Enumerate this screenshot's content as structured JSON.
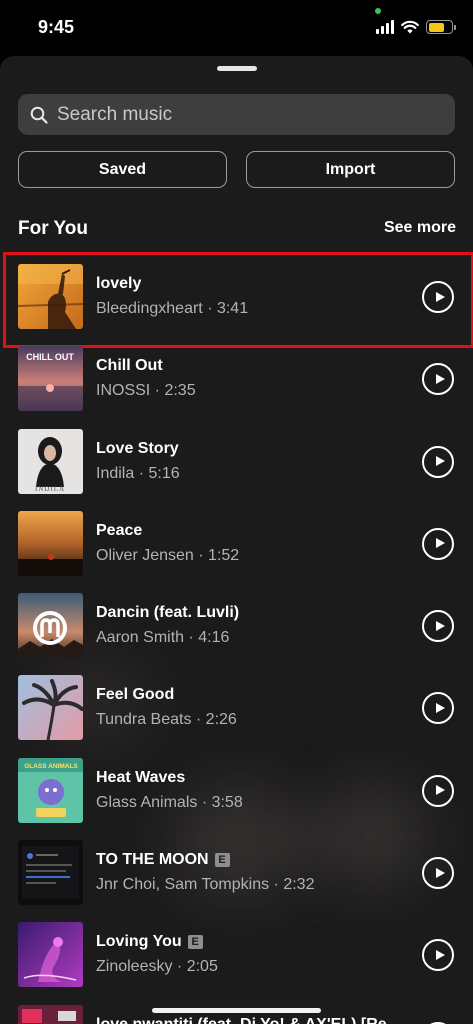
{
  "status_bar": {
    "time": "9:45",
    "signal_icon": "cellular-signal-icon",
    "wifi_icon": "wifi-icon",
    "battery_icon": "battery-icon",
    "battery_color": "#f5c518",
    "privacy_indicator_color": "#34c759"
  },
  "search": {
    "placeholder": "Search music",
    "icon": "search-icon"
  },
  "buttons": {
    "saved": "Saved",
    "import": "Import"
  },
  "section": {
    "title": "For You",
    "see_more": "See more"
  },
  "selection_color": "#e30f18",
  "tracks": [
    {
      "title": "lovely",
      "meta": "Bleedingxheart · 3:41",
      "explicit": false,
      "selected": true
    },
    {
      "title": "Chill Out",
      "meta": "INOSSI · 2:35",
      "explicit": false,
      "cover_text": "CHILL OUT"
    },
    {
      "title": "Love Story",
      "meta": "Indila · 5:16",
      "explicit": false,
      "cover_text": "INDILA"
    },
    {
      "title": "Peace",
      "meta": "Oliver Jensen · 1:52",
      "explicit": false
    },
    {
      "title": "Dancin (feat. Luvli)",
      "meta": "Aaron Smith · 4:16",
      "explicit": false
    },
    {
      "title": "Feel Good",
      "meta": "Tundra Beats · 2:26",
      "explicit": false
    },
    {
      "title": "Heat Waves",
      "meta": "Glass Animals · 3:58",
      "explicit": false,
      "cover_text": "GLASS ANIMALS"
    },
    {
      "title": "TO THE MOON",
      "meta": "Jnr Choi, Sam Tompkins · 2:32",
      "explicit": true
    },
    {
      "title": "Loving You",
      "meta": "Zinoleesky · 2:05",
      "explicit": true
    },
    {
      "title": "love nwantiti (feat. Dj Yo! & AX'EL) [Re",
      "meta": "",
      "explicit": false
    }
  ],
  "explicit_label": "E",
  "play_icon": "play-circle-icon"
}
